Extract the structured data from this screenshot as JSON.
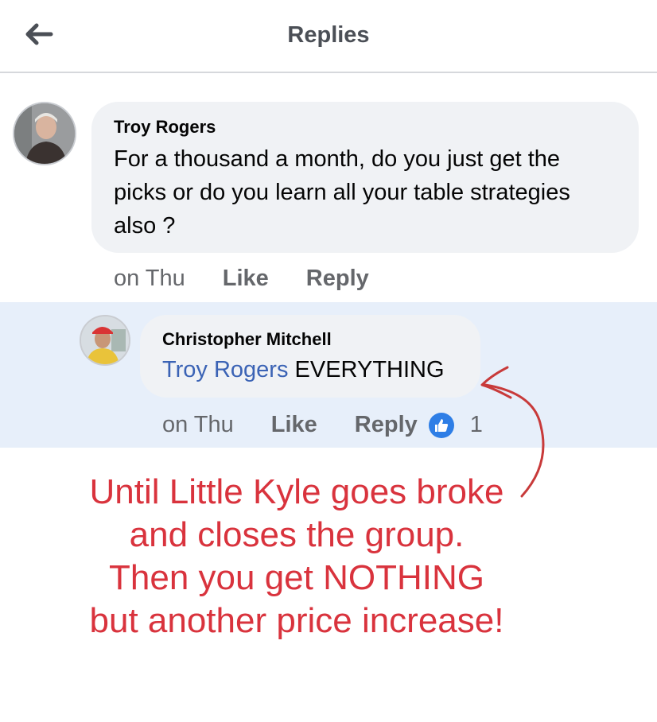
{
  "header": {
    "title": "Replies",
    "back_icon": "arrow-left-icon"
  },
  "comment": {
    "author": "Troy Rogers",
    "text": "For a thousand a month, do you just get the picks or do you learn all your table strategies also ?",
    "time": "on Thu",
    "like_label": "Like",
    "reply_label": "Reply"
  },
  "reply": {
    "author": "Christopher Mitchell",
    "mention": "Troy Rogers",
    "text": "EVERYTHING",
    "time": "on Thu",
    "like_label": "Like",
    "reply_label": "Reply",
    "reaction_count": "1",
    "reaction_icon": "thumbs-up-icon",
    "highlight_color": "#e7effa"
  },
  "annotation": {
    "text": "Until Little Kyle goes broke and closes the group. Then you get NOTHING but another price increase!",
    "color": "#d9333d"
  }
}
